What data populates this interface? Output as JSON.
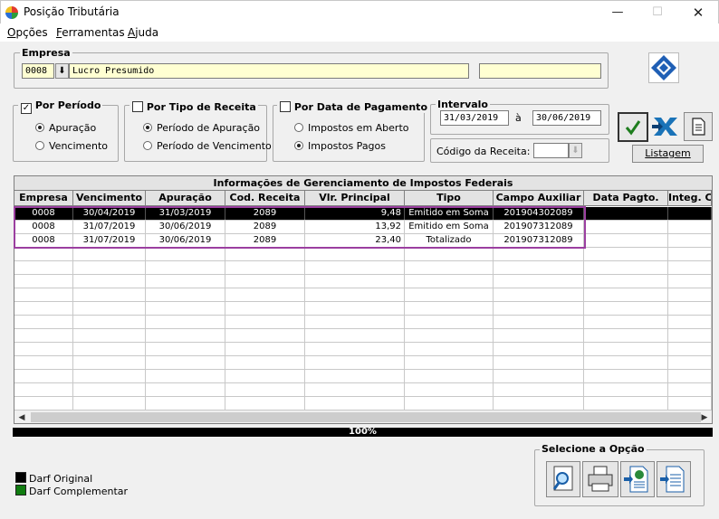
{
  "window": {
    "title": "Posição Tributária"
  },
  "menu": [
    {
      "label_u": "O",
      "label_rest": "pções"
    },
    {
      "label_u": "F",
      "label_rest": "erramentas"
    },
    {
      "label_u": "A",
      "label_rest": "juda"
    }
  ],
  "empresa": {
    "title": "Empresa",
    "code": "0008",
    "name": "Lucro Presumido",
    "extra": ""
  },
  "por_periodo": {
    "title": "Por Período",
    "checked": true,
    "options": [
      "Apuração",
      "Vencimento"
    ],
    "selected": 0
  },
  "por_tipo_receita": {
    "title": "Por Tipo de Receita",
    "checked": false,
    "options": [
      "Período de Apuração",
      "Período de Vencimento"
    ],
    "selected": 0
  },
  "por_data_pagamento": {
    "title": "Por Data de Pagamento",
    "checked": false,
    "options": [
      "Impostos em Aberto",
      "Impostos Pagos"
    ],
    "selected": 1
  },
  "intervalo": {
    "title": "Intervalo",
    "start": "31/03/2019",
    "separator": "à",
    "end": "30/06/2019"
  },
  "codigo_receita": {
    "label": "Código da Receita:",
    "value": ""
  },
  "listagem_label": "Listagem",
  "grid": {
    "caption": "Informações de Gerenciamento de Impostos Federais",
    "columns": [
      "Empresa",
      "Vencimento",
      "Apuração",
      "Cod. Receita",
      "Vlr. Principal",
      "Tipo",
      "Campo Auxiliar",
      "Data Pagto.",
      "Integ. C"
    ],
    "rows": [
      [
        "0008",
        "30/04/2019",
        "31/03/2019",
        "2089",
        "9,48",
        "Emitido em Soma",
        "201904302089",
        "",
        ""
      ],
      [
        "0008",
        "31/07/2019",
        "30/06/2019",
        "2089",
        "13,92",
        "Emitido em Soma",
        "201907312089",
        "",
        ""
      ],
      [
        "0008",
        "31/07/2019",
        "30/06/2019",
        "2089",
        "23,40",
        "Totalizado",
        "201907312089",
        "",
        ""
      ]
    ],
    "empty_rows": 13
  },
  "progress": {
    "label": "100%",
    "value": 100
  },
  "legend": [
    {
      "label": "Darf Original",
      "color": "#000000"
    },
    {
      "label": "Darf Complementar",
      "color": "#107c10"
    }
  ],
  "selecione": {
    "title": "Selecione a Opção"
  },
  "colors": {
    "highlight": "#9b3fa0",
    "field_bg": "#ffffd2"
  }
}
